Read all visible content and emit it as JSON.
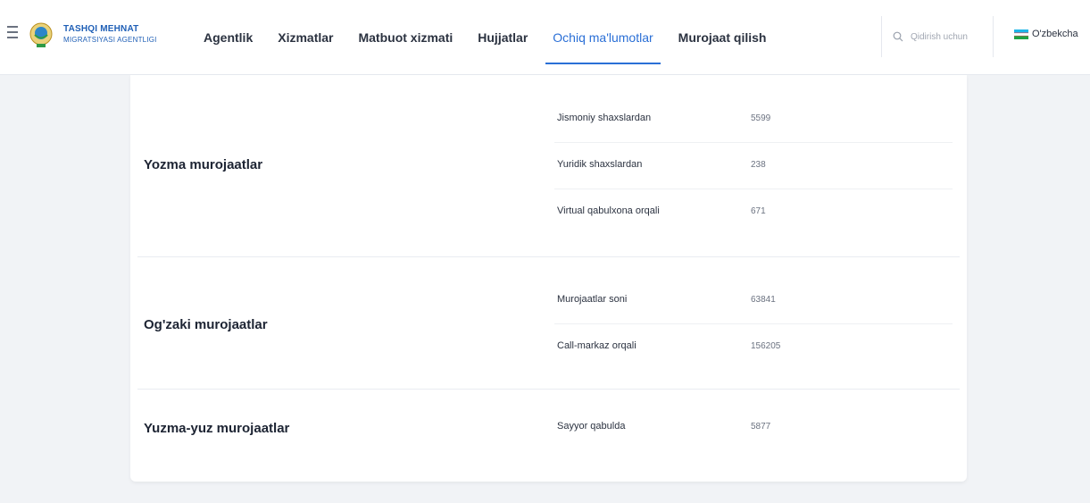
{
  "header": {
    "logo": {
      "title": "TASHQI MEHNAT",
      "subtitle": "MIGRATSIYASI AGENTLIGI"
    },
    "nav": [
      {
        "label": "Agentlik",
        "active": false
      },
      {
        "label": "Xizmatlar",
        "active": false
      },
      {
        "label": "Matbuot xizmati",
        "active": false
      },
      {
        "label": "Hujjatlar",
        "active": false
      },
      {
        "label": "Ochiq ma'lumotlar",
        "active": true
      },
      {
        "label": "Murojaat qilish",
        "active": false
      }
    ],
    "search": {
      "placeholder": "Qidirish uchun"
    },
    "language": {
      "label": "O'zbekcha"
    }
  },
  "colors": {
    "accent": "#2a6fd6",
    "logo": "#1f5fb6",
    "flag_blue": "#1eb5e8",
    "flag_green": "#1fa344"
  },
  "groups": [
    {
      "name": "Yozma murojaatlar",
      "rows": [
        {
          "label": "Jismoniy shaxslardan",
          "value": "5599"
        },
        {
          "label": "Yuridik shaxslardan",
          "value": "238"
        },
        {
          "label": "Virtual qabulxona orqali",
          "value": "671"
        }
      ]
    },
    {
      "name": "Og'zaki murojaatlar",
      "rows": [
        {
          "label": "Murojaatlar soni",
          "value": "63841"
        },
        {
          "label": "Call-markaz orqali",
          "value": "156205"
        }
      ]
    },
    {
      "name": "Yuzma-yuz murojaatlar",
      "rows": [
        {
          "label": "Sayyor qabulda",
          "value": "5877"
        }
      ]
    }
  ]
}
